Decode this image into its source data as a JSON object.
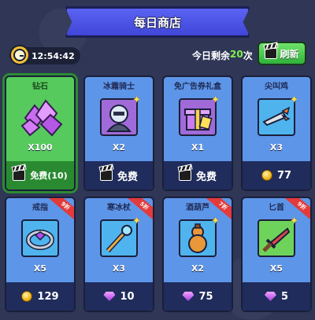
{
  "header": {
    "title": "每日商店"
  },
  "timer": {
    "value": "12:54:42",
    "icon": "stopwatch-icon"
  },
  "refresh": {
    "remain_prefix": "今日剩余",
    "remain_count": "20",
    "remain_suffix": "次",
    "button_label": "刷新",
    "icon": "ad-video-icon"
  },
  "items": [
    {
      "name": "钻石",
      "qty": "X100",
      "price": "免费(10)",
      "currency": "ad",
      "discount": "",
      "image": "purple-crystals-icon",
      "highlight": true
    },
    {
      "name": "冰霜骑士",
      "qty": "X2",
      "price": "免费",
      "currency": "ad",
      "discount": "",
      "image": "frost-knight-icon",
      "highlight": false
    },
    {
      "name": "免广告券礼盒",
      "qty": "X1",
      "price": "免费",
      "currency": "ad",
      "discount": "",
      "image": "gift-box-icon",
      "highlight": false
    },
    {
      "name": "尖叫鸡",
      "qty": "X3",
      "price": "77",
      "currency": "coin",
      "discount": "",
      "image": "screaming-chicken-icon",
      "highlight": false
    },
    {
      "name": "戒指",
      "qty": "X5",
      "price": "129",
      "currency": "coin",
      "discount": "9折",
      "image": "ring-icon",
      "highlight": false
    },
    {
      "name": "寒冰杖",
      "qty": "X3",
      "price": "10",
      "currency": "gem",
      "discount": "5折",
      "image": "ice-staff-icon",
      "highlight": false
    },
    {
      "name": "酒葫芦",
      "qty": "X2",
      "price": "75",
      "currency": "gem",
      "discount": "7折",
      "image": "gourd-icon",
      "highlight": false
    },
    {
      "name": "匕首",
      "qty": "X5",
      "price": "5",
      "currency": "gem",
      "discount": "9折",
      "image": "dagger-icon",
      "highlight": false
    }
  ],
  "colors": {
    "card_blue": "#5d95e8",
    "card_green": "#56ca5c",
    "price_bar": "#1f2c5c",
    "accent_green": "#7ff24a"
  }
}
